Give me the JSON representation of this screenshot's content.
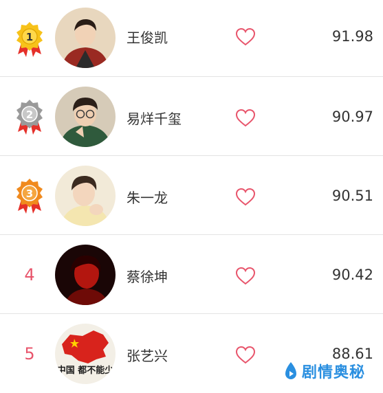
{
  "ranking": [
    {
      "rank_label": "1",
      "rank_type": "gold-medal",
      "name": "王俊凯",
      "score": "91.98"
    },
    {
      "rank_label": "2",
      "rank_type": "silver-medal",
      "name": "易烊千玺",
      "score": "90.97"
    },
    {
      "rank_label": "3",
      "rank_type": "bronze-medal",
      "name": "朱一龙",
      "score": "90.51"
    },
    {
      "rank_label": "4",
      "rank_type": "number",
      "name": "蔡徐坤",
      "score": "90.42"
    },
    {
      "rank_label": "5",
      "rank_type": "number",
      "name": "张艺兴",
      "score": "88.61"
    }
  ],
  "avatar5_text": "中国 都不能少",
  "watermark": {
    "text": "剧情奥秘",
    "icon": "play-drop-icon"
  },
  "colors": {
    "accent": "#e8546b",
    "gold": "#f7c21a",
    "silver": "#9a9a9a",
    "bronze": "#f08a1e",
    "ribbon": "#e5302a",
    "watermark": "#2a8fe0"
  }
}
